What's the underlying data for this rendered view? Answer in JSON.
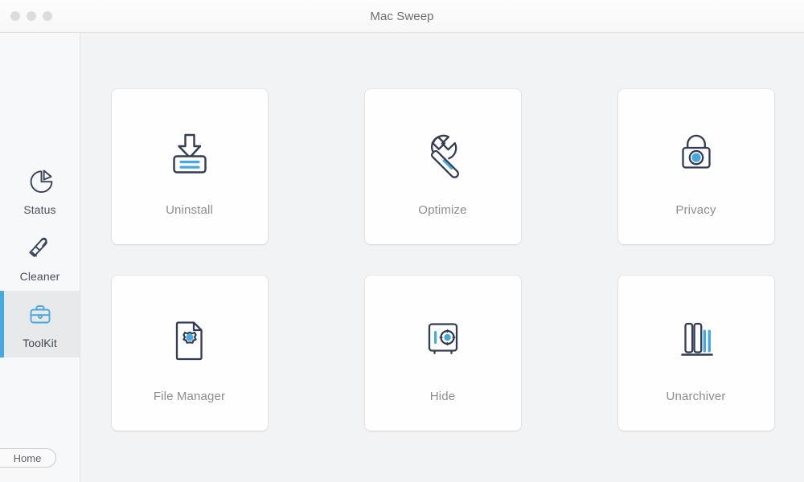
{
  "window": {
    "title": "Mac Sweep",
    "traffic_lights": [
      "close-button",
      "minimize-button",
      "zoom-button"
    ]
  },
  "sidebar": {
    "items": [
      {
        "label": "Status",
        "icon": "pie-chart-icon",
        "active": false
      },
      {
        "label": "Cleaner",
        "icon": "brush-icon",
        "active": false
      },
      {
        "label": "ToolKit",
        "icon": "toolbox-icon",
        "active": true
      }
    ],
    "home_button": {
      "label": "Home"
    }
  },
  "main": {
    "tools": [
      {
        "label": "Uninstall",
        "icon": "uninstall-download-icon"
      },
      {
        "label": "Optimize",
        "icon": "wrench-icon"
      },
      {
        "label": "Privacy",
        "icon": "padlock-icon"
      },
      {
        "label": "File Manager",
        "icon": "document-gear-icon"
      },
      {
        "label": "Hide",
        "icon": "safe-vault-icon"
      },
      {
        "label": "Unarchiver",
        "icon": "archive-bars-icon"
      }
    ]
  },
  "colors": {
    "accent_blue": "#45a8e0",
    "icon_navy": "#343c54",
    "label_gray": "#8a8d92",
    "content_bg": "#f2f3f5",
    "sidebar_bg": "#f7f8f9",
    "card_bg": "#fefefe",
    "active_row_bg": "#e8e9ea"
  }
}
